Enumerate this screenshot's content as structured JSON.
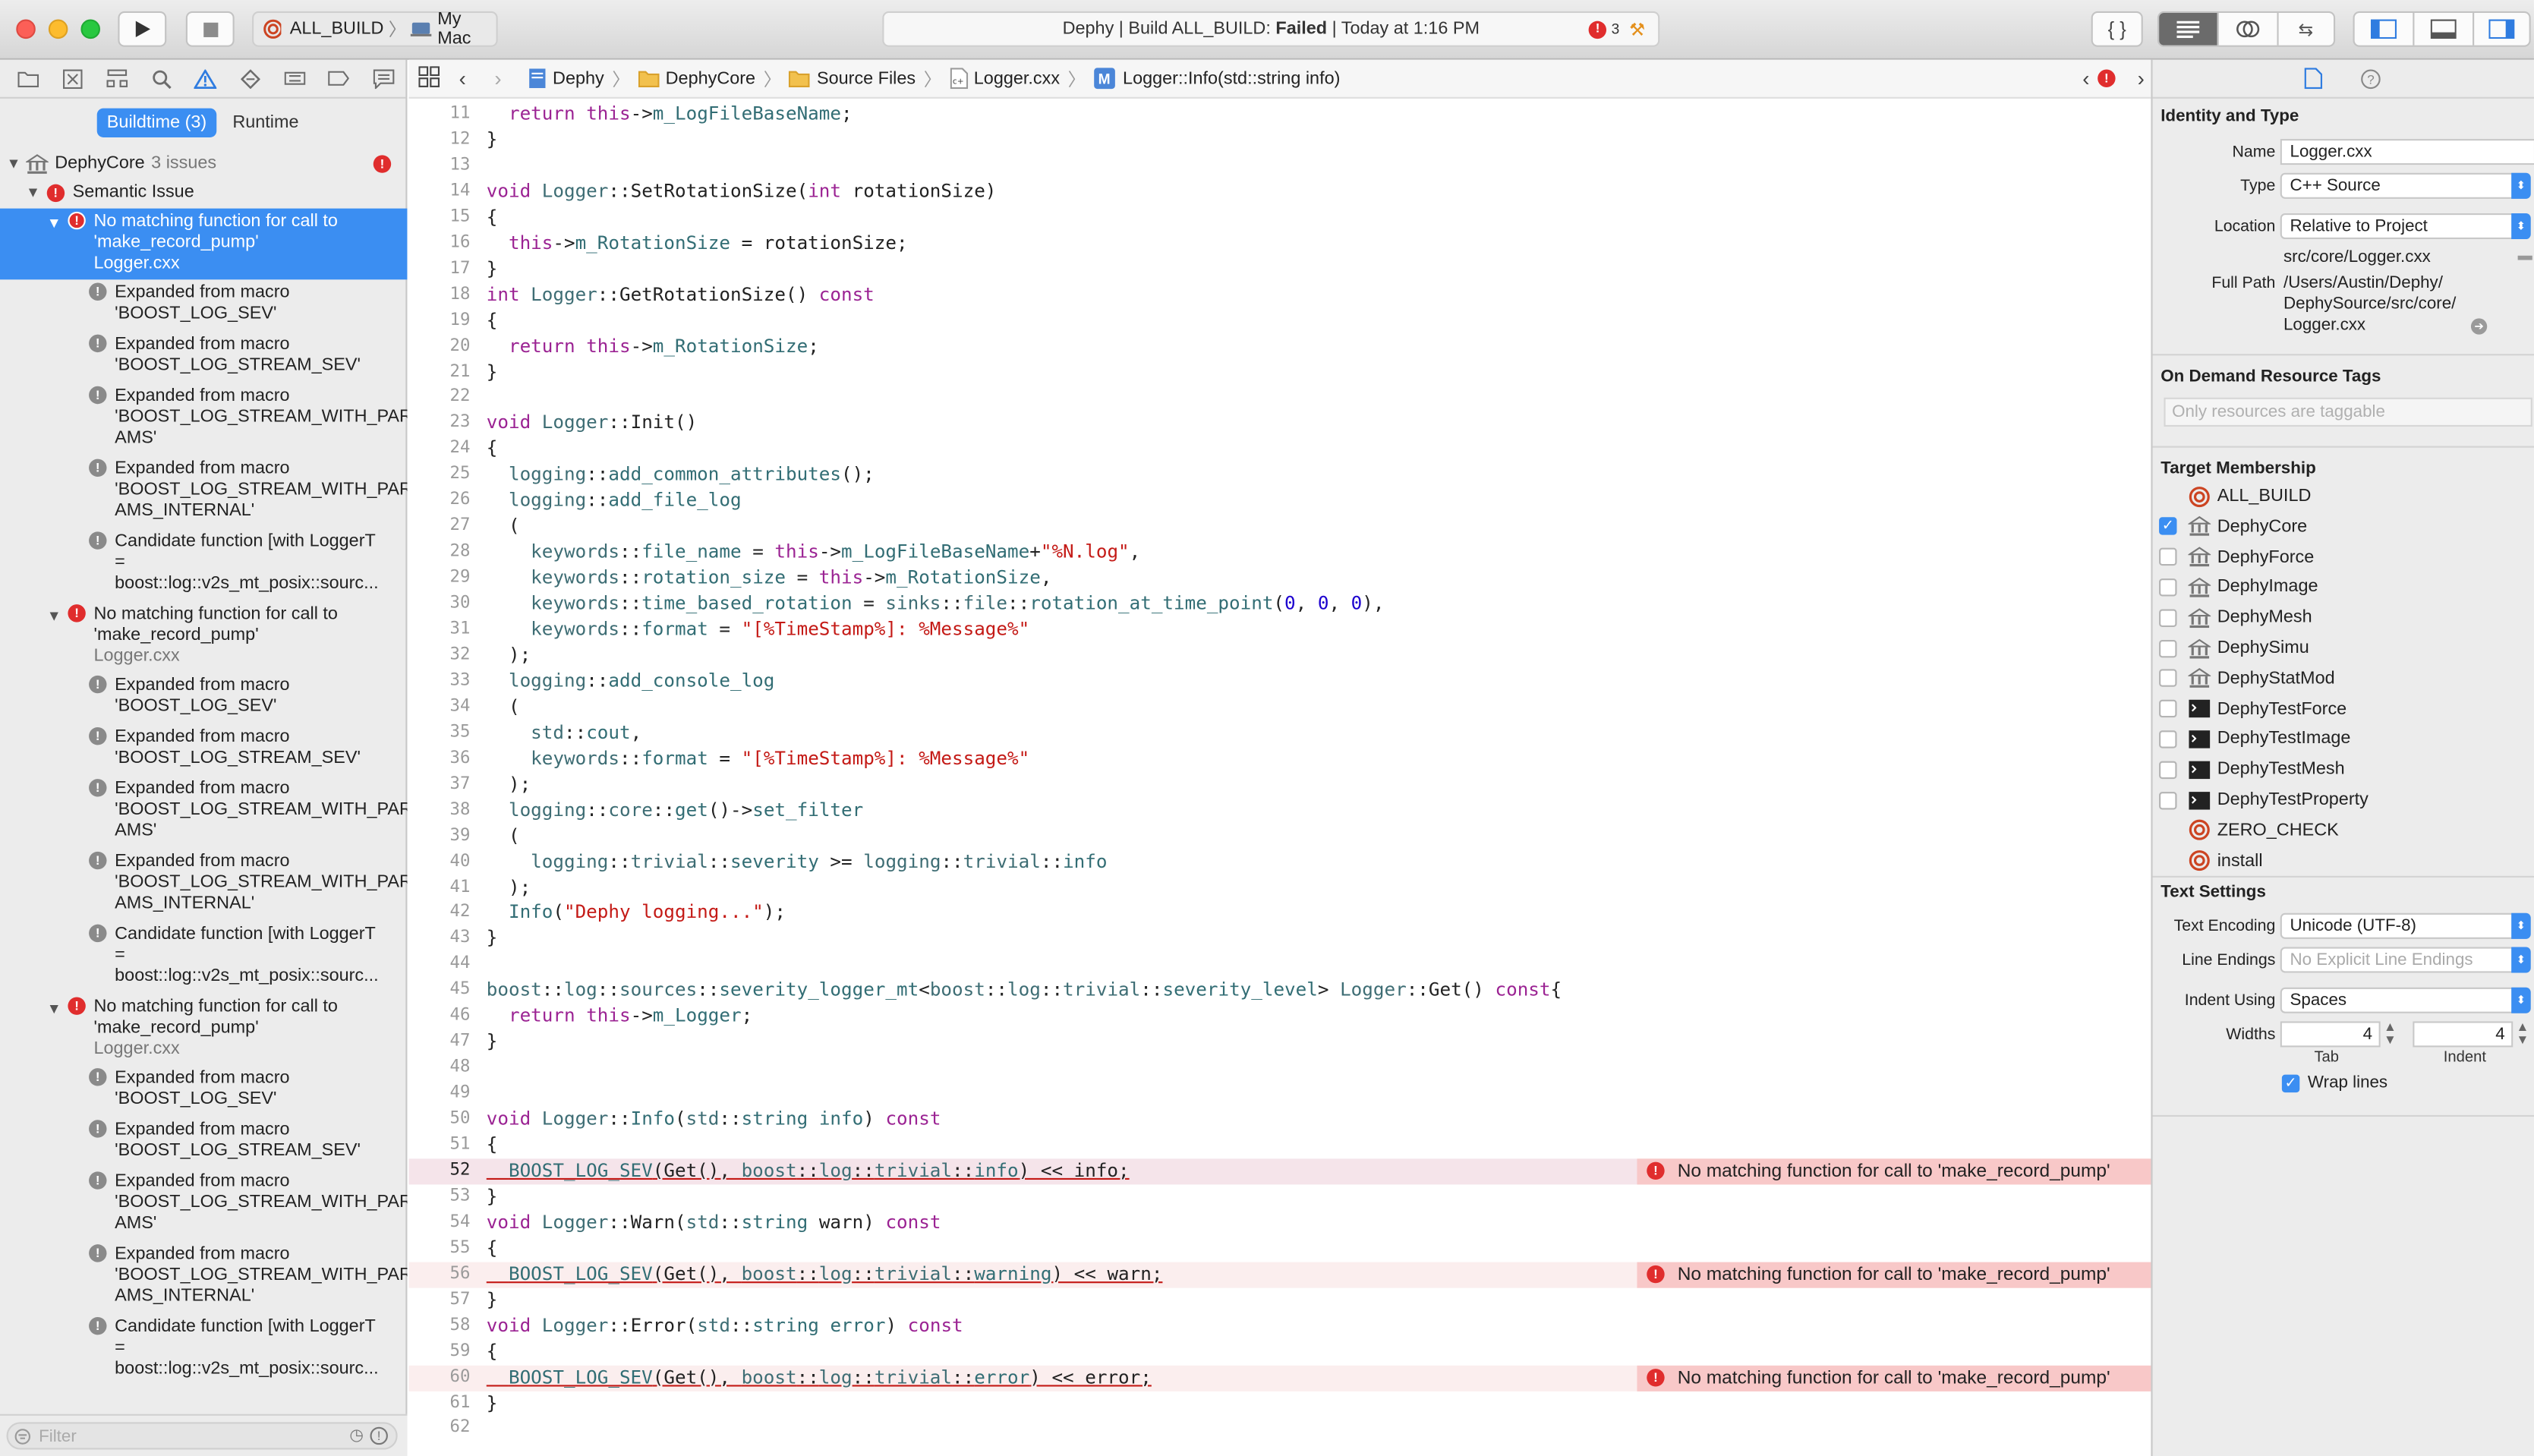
{
  "toolbar": {
    "scheme": "ALL_BUILD",
    "destination": "My Mac",
    "activity_project": "Dephy",
    "activity_sep": " | ",
    "activity_build": "Build ALL_BUILD: ",
    "activity_status": "Failed",
    "activity_time": " | Today at 1:16 PM",
    "error_count": "3"
  },
  "navigator": {
    "tabs": [
      "Buildtime (3)",
      "Runtime"
    ],
    "project": "DephyCore",
    "project_count": "3 issues",
    "group": "Semantic Issue",
    "filter_placeholder": "Filter",
    "rows": [
      {
        "kind": "error",
        "selected": true,
        "lines": [
          "No matching function for call to",
          "'make_record_pump'"
        ],
        "file": "Logger.cxx"
      },
      {
        "kind": "note",
        "lines": [
          "Expanded from macro",
          "'BOOST_LOG_SEV'"
        ]
      },
      {
        "kind": "note",
        "lines": [
          "Expanded from macro",
          "'BOOST_LOG_STREAM_SEV'"
        ]
      },
      {
        "kind": "note",
        "lines": [
          "Expanded from macro",
          "'BOOST_LOG_STREAM_WITH_PAR",
          "AMS'"
        ]
      },
      {
        "kind": "note",
        "lines": [
          "Expanded from macro",
          "'BOOST_LOG_STREAM_WITH_PAR",
          "AMS_INTERNAL'"
        ]
      },
      {
        "kind": "note",
        "lines": [
          "Candidate function [with LoggerT",
          "=",
          "boost::log::v2s_mt_posix::sourc..."
        ]
      },
      {
        "kind": "error",
        "lines": [
          "No matching function for call to",
          "'make_record_pump'"
        ],
        "file": "Logger.cxx"
      },
      {
        "kind": "note",
        "lines": [
          "Expanded from macro",
          "'BOOST_LOG_SEV'"
        ]
      },
      {
        "kind": "note",
        "lines": [
          "Expanded from macro",
          "'BOOST_LOG_STREAM_SEV'"
        ]
      },
      {
        "kind": "note",
        "lines": [
          "Expanded from macro",
          "'BOOST_LOG_STREAM_WITH_PAR",
          "AMS'"
        ]
      },
      {
        "kind": "note",
        "lines": [
          "Expanded from macro",
          "'BOOST_LOG_STREAM_WITH_PAR",
          "AMS_INTERNAL'"
        ]
      },
      {
        "kind": "note",
        "lines": [
          "Candidate function [with LoggerT",
          "=",
          "boost::log::v2s_mt_posix::sourc..."
        ]
      },
      {
        "kind": "error",
        "lines": [
          "No matching function for call to",
          "'make_record_pump'"
        ],
        "file": "Logger.cxx"
      },
      {
        "kind": "note",
        "lines": [
          "Expanded from macro",
          "'BOOST_LOG_SEV'"
        ]
      },
      {
        "kind": "note",
        "lines": [
          "Expanded from macro",
          "'BOOST_LOG_STREAM_SEV'"
        ]
      },
      {
        "kind": "note",
        "lines": [
          "Expanded from macro",
          "'BOOST_LOG_STREAM_WITH_PAR",
          "AMS'"
        ]
      },
      {
        "kind": "note",
        "lines": [
          "Expanded from macro",
          "'BOOST_LOG_STREAM_WITH_PAR",
          "AMS_INTERNAL'"
        ]
      },
      {
        "kind": "note",
        "lines": [
          "Candidate function [with LoggerT",
          "=",
          "boost::log::v2s_mt_posix::sourc..."
        ]
      }
    ]
  },
  "jumpbar": {
    "crumbs": [
      "Dephy",
      "DephyCore",
      "Source Files",
      "Logger.cxx",
      "Logger::Info(std::string info)"
    ]
  },
  "editor": {
    "lines": [
      {
        "n": "11",
        "code": "  return this->m_LogFileBaseName;"
      },
      {
        "n": "12",
        "code": "}"
      },
      {
        "n": "13",
        "code": ""
      },
      {
        "n": "14",
        "code": "void Logger::SetRotationSize(int rotationSize)"
      },
      {
        "n": "15",
        "code": "{"
      },
      {
        "n": "16",
        "code": "  this->m_RotationSize = rotationSize;"
      },
      {
        "n": "17",
        "code": "}"
      },
      {
        "n": "18",
        "code": "int Logger::GetRotationSize() const"
      },
      {
        "n": "19",
        "code": "{"
      },
      {
        "n": "20",
        "code": "  return this->m_RotationSize;"
      },
      {
        "n": "21",
        "code": "}"
      },
      {
        "n": "22",
        "code": ""
      },
      {
        "n": "23",
        "code": "void Logger::Init()"
      },
      {
        "n": "24",
        "code": "{"
      },
      {
        "n": "25",
        "code": "  logging::add_common_attributes();"
      },
      {
        "n": "26",
        "code": "  logging::add_file_log"
      },
      {
        "n": "27",
        "code": "  ("
      },
      {
        "n": "28",
        "code": "    keywords::file_name = this->m_LogFileBaseName+\"%N.log\","
      },
      {
        "n": "29",
        "code": "    keywords::rotation_size = this->m_RotationSize,"
      },
      {
        "n": "30",
        "code": "    keywords::time_based_rotation = sinks::file::rotation_at_time_point(0, 0, 0),"
      },
      {
        "n": "31",
        "code": "    keywords::format = \"[%TimeStamp%]: %Message%\""
      },
      {
        "n": "32",
        "code": "  );"
      },
      {
        "n": "33",
        "code": "  logging::add_console_log"
      },
      {
        "n": "34",
        "code": "  ("
      },
      {
        "n": "35",
        "code": "    std::cout,"
      },
      {
        "n": "36",
        "code": "    keywords::format = \"[%TimeStamp%]: %Message%\""
      },
      {
        "n": "37",
        "code": "  );"
      },
      {
        "n": "38",
        "code": "  logging::core::get()->set_filter"
      },
      {
        "n": "39",
        "code": "  ("
      },
      {
        "n": "40",
        "code": "    logging::trivial::severity >= logging::trivial::info"
      },
      {
        "n": "41",
        "code": "  );"
      },
      {
        "n": "42",
        "code": "  Info(\"Dephy logging...\");"
      },
      {
        "n": "43",
        "code": "}"
      },
      {
        "n": "44",
        "code": ""
      },
      {
        "n": "45",
        "code": "boost::log::sources::severity_logger_mt<boost::log::trivial::severity_level> Logger::Get() const{"
      },
      {
        "n": "46",
        "code": "  return this->m_Logger;"
      },
      {
        "n": "47",
        "code": "}"
      },
      {
        "n": "48",
        "code": ""
      },
      {
        "n": "49",
        "code": ""
      },
      {
        "n": "50",
        "code": "void Logger::Info(std::string info) const"
      },
      {
        "n": "51",
        "code": "{"
      },
      {
        "n": "52",
        "code": "  BOOST_LOG_SEV(Get(), boost::log::trivial::info) << info;",
        "error": "No matching function for call to 'make_record_pump'",
        "current": true
      },
      {
        "n": "53",
        "code": "}"
      },
      {
        "n": "54",
        "code": "void Logger::Warn(std::string warn) const"
      },
      {
        "n": "55",
        "code": "{"
      },
      {
        "n": "56",
        "code": "  BOOST_LOG_SEV(Get(), boost::log::trivial::warning) << warn;",
        "error": "No matching function for call to 'make_record_pump'"
      },
      {
        "n": "57",
        "code": "}"
      },
      {
        "n": "58",
        "code": "void Logger::Error(std::string error) const"
      },
      {
        "n": "59",
        "code": "{"
      },
      {
        "n": "60",
        "code": "  BOOST_LOG_SEV(Get(), boost::log::trivial::error) << error;",
        "error": "No matching function for call to 'make_record_pump'"
      },
      {
        "n": "61",
        "code": "}"
      },
      {
        "n": "62",
        "code": ""
      }
    ]
  },
  "inspector": {
    "identity_header": "Identity and Type",
    "name_label": "Name",
    "name_value": "Logger.cxx",
    "type_label": "Type",
    "type_value": "C++ Source",
    "location_label": "Location",
    "location_value": "Relative to Project",
    "location_path": "src/core/Logger.cxx",
    "fullpath_label": "Full Path",
    "fullpath_lines": [
      "/Users/Austin/Dephy/",
      "DephySource/src/core/",
      "Logger.cxx"
    ],
    "odr_header": "On Demand Resource Tags",
    "odr_placeholder": "Only resources are taggable",
    "tm_header": "Target Membership",
    "targets": [
      {
        "name": "ALL_BUILD",
        "icon": "target",
        "checkbox": false,
        "checked": false
      },
      {
        "name": "DephyCore",
        "icon": "library",
        "checkbox": true,
        "checked": true
      },
      {
        "name": "DephyForce",
        "icon": "library",
        "checkbox": true,
        "checked": false
      },
      {
        "name": "DephyImage",
        "icon": "library",
        "checkbox": true,
        "checked": false
      },
      {
        "name": "DephyMesh",
        "icon": "library",
        "checkbox": true,
        "checked": false
      },
      {
        "name": "DephySimu",
        "icon": "library",
        "checkbox": true,
        "checked": false
      },
      {
        "name": "DephyStatMod",
        "icon": "library",
        "checkbox": true,
        "checked": false
      },
      {
        "name": "DephyTestForce",
        "icon": "terminal",
        "checkbox": true,
        "checked": false
      },
      {
        "name": "DephyTestImage",
        "icon": "terminal",
        "checkbox": true,
        "checked": false
      },
      {
        "name": "DephyTestMesh",
        "icon": "terminal",
        "checkbox": true,
        "checked": false
      },
      {
        "name": "DephyTestProperty",
        "icon": "terminal",
        "checkbox": true,
        "checked": false
      },
      {
        "name": "ZERO_CHECK",
        "icon": "target",
        "checkbox": false,
        "checked": false
      },
      {
        "name": "install",
        "icon": "target",
        "checkbox": false,
        "checked": false
      }
    ],
    "text_header": "Text Settings",
    "encoding_label": "Text Encoding",
    "encoding_value": "Unicode (UTF-8)",
    "endings_label": "Line Endings",
    "endings_value": "No Explicit Line Endings",
    "indent_label": "Indent Using",
    "indent_value": "Spaces",
    "widths_label": "Widths",
    "tab_value": "4",
    "indent_width_value": "4",
    "tab_caption": "Tab",
    "indent_caption": "Indent",
    "wrap_label": "Wrap lines"
  },
  "colors": {
    "accent": "#3b8ef2",
    "error": "#e02d2d",
    "error_line": "#fbeeee",
    "error_msg": "#f8c8c8"
  }
}
